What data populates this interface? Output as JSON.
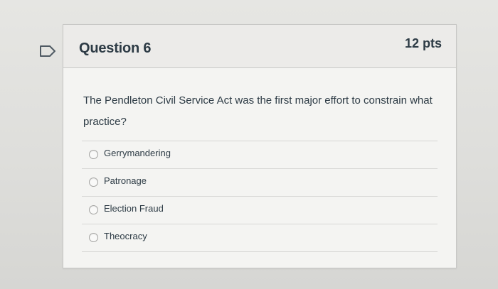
{
  "question": {
    "title": "Question 6",
    "points": "12 pts",
    "text": "The Pendleton Civil Service Act was the first major effort to constrain what practice?",
    "answers": [
      {
        "label": "Gerrymandering"
      },
      {
        "label": "Patronage"
      },
      {
        "label": "Election Fraud"
      },
      {
        "label": "Theocracy"
      }
    ]
  },
  "icons": {
    "flag": "flag-icon",
    "radio": "radio-button-icon"
  },
  "colors": {
    "text": "#2d3b45",
    "header_bg": "#ecebe9",
    "card_bg": "#f4f4f2",
    "border": "#c8c8c6"
  }
}
